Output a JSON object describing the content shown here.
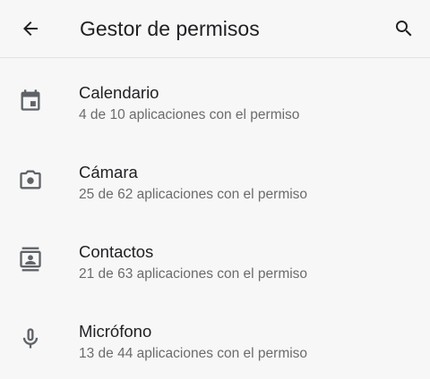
{
  "header": {
    "title": "Gestor de permisos",
    "back_icon": "arrow-back-icon",
    "search_icon": "search-icon"
  },
  "permissions": [
    {
      "label": "Calendario",
      "subtitle": "4 de 10 aplicaciones con el permiso",
      "icon": "calendar-icon"
    },
    {
      "label": "Cámara",
      "subtitle": "25 de 62 aplicaciones con el permiso",
      "icon": "camera-icon"
    },
    {
      "label": "Contactos",
      "subtitle": "21 de 63 aplicaciones con el permiso",
      "icon": "contacts-icon"
    },
    {
      "label": "Micrófono",
      "subtitle": "13 de 44 aplicaciones con el permiso",
      "icon": "microphone-icon"
    }
  ],
  "colors": {
    "background": "#f7f7f7",
    "text_primary": "#202124",
    "text_secondary": "#6b6b6b",
    "icon": "#5f6368"
  }
}
